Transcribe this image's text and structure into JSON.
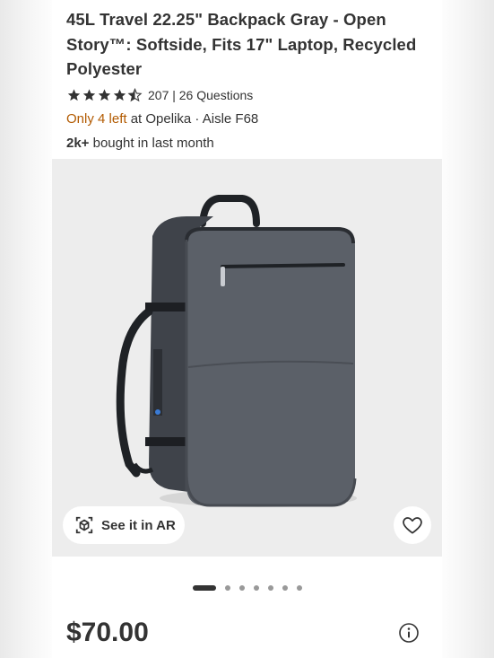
{
  "product": {
    "title": "45L Travel 22.25\" Backpack Gray - Open Story™: Softside, Fits 17\" Laptop, Recycled Polyester",
    "rating_value": 4.5,
    "rating_text": "207 | 26 Questions",
    "stock_low": "Only 4 left",
    "stock_rest": " at Opelika · Aisle F68",
    "bought_bold": "2k+",
    "bought_rest": " bought in last month",
    "price": "$70.00"
  },
  "image": {
    "ar_label": "See it in AR",
    "carousel_count": 7,
    "carousel_active": 0
  },
  "colors": {
    "text": "#333333",
    "stock_low": "#b25a00",
    "backpack": "#5b6068"
  },
  "icons": [
    "star-icon",
    "half-star-icon",
    "ar-cube-icon",
    "heart-icon",
    "info-icon"
  ]
}
